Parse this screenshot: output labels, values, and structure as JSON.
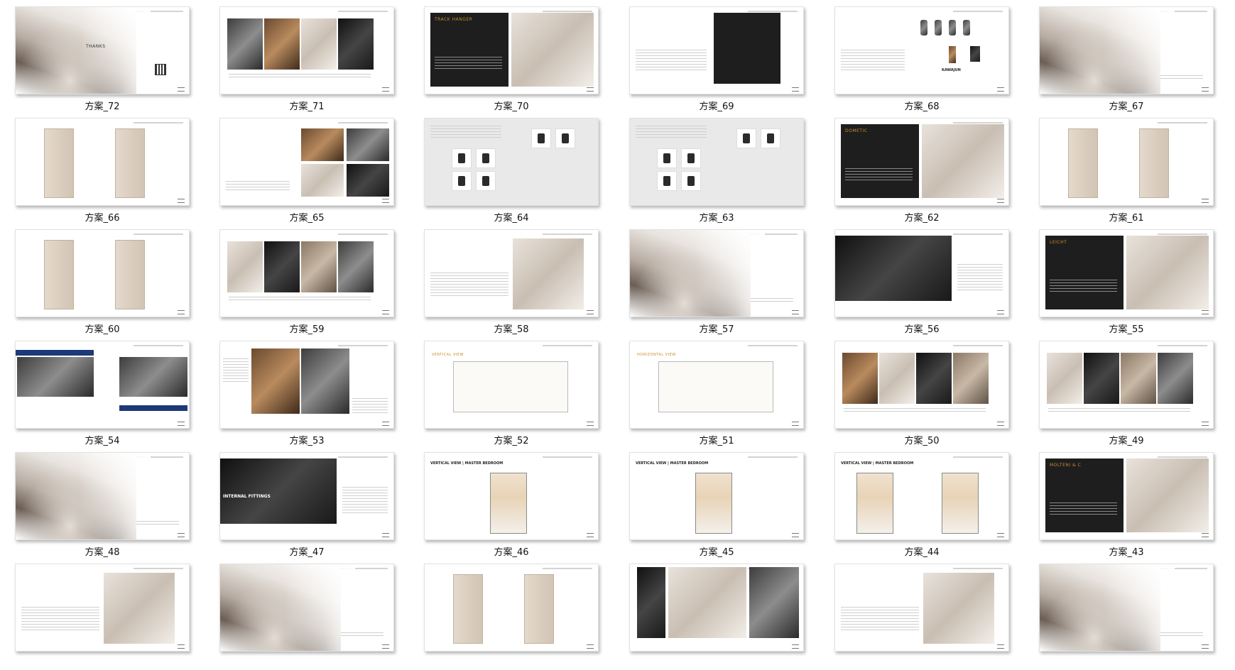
{
  "thumbnails": [
    {
      "id": "t72",
      "caption": "方案_72",
      "kind": "thanks",
      "label": "THANKS"
    },
    {
      "id": "t71",
      "caption": "方案_71",
      "kind": "photos-strip"
    },
    {
      "id": "t70",
      "caption": "方案_70",
      "kind": "dark-title",
      "label": "TRACK HANGER"
    },
    {
      "id": "t69",
      "caption": "方案_69",
      "kind": "text-dark-right"
    },
    {
      "id": "t68",
      "caption": "方案_68",
      "kind": "hardware",
      "label": "KAWAJUN"
    },
    {
      "id": "t67",
      "caption": "方案_67",
      "kind": "room"
    },
    {
      "id": "t66",
      "caption": "方案_66",
      "kind": "cabinets-2"
    },
    {
      "id": "t65",
      "caption": "方案_65",
      "kind": "text-grid-right"
    },
    {
      "id": "t64",
      "caption": "方案_64",
      "kind": "gray-icons"
    },
    {
      "id": "t63",
      "caption": "方案_63",
      "kind": "gray-appliances"
    },
    {
      "id": "t62",
      "caption": "方案_62",
      "kind": "dark-title",
      "label": "DOMETIC"
    },
    {
      "id": "t61",
      "caption": "方案_61",
      "kind": "cabinets-2"
    },
    {
      "id": "t60",
      "caption": "方案_60",
      "kind": "cabinets-2"
    },
    {
      "id": "t59",
      "caption": "方案_59",
      "kind": "photos-strip"
    },
    {
      "id": "t58",
      "caption": "方案_58",
      "kind": "text-photo-right"
    },
    {
      "id": "t57",
      "caption": "方案_57",
      "kind": "room"
    },
    {
      "id": "t56",
      "caption": "方案_56",
      "kind": "big-photo-left"
    },
    {
      "id": "t55",
      "caption": "方案_55",
      "kind": "dark-title",
      "label": "LEICHT"
    },
    {
      "id": "t54",
      "caption": "方案_54",
      "kind": "people"
    },
    {
      "id": "t53",
      "caption": "方案_53",
      "kind": "text-photo-mid"
    },
    {
      "id": "t52",
      "caption": "方案_52",
      "kind": "drawing",
      "label": "VERTICAL VIEW"
    },
    {
      "id": "t51",
      "caption": "方案_51",
      "kind": "drawing",
      "label": "HORIZONTAL VIEW"
    },
    {
      "id": "t50",
      "caption": "方案_50",
      "kind": "photos-strip"
    },
    {
      "id": "t49",
      "caption": "方案_49",
      "kind": "photos-strip"
    },
    {
      "id": "t48",
      "caption": "方案_48",
      "kind": "room"
    },
    {
      "id": "t47",
      "caption": "方案_47",
      "kind": "big-photo-left",
      "label": "INTERNAL FITTINGS"
    },
    {
      "id": "t46",
      "caption": "方案_46",
      "kind": "wardrobe-1",
      "label": "VERTICAL VIEW | MASTER BEDROOM"
    },
    {
      "id": "t45",
      "caption": "方案_45",
      "kind": "wardrobe-1",
      "label": "VERTICAL VIEW | MASTER BEDROOM"
    },
    {
      "id": "t44",
      "caption": "方案_44",
      "kind": "wardrobe-2",
      "label": "VERTICAL VIEW | MASTER BEDROOM"
    },
    {
      "id": "t43",
      "caption": "方案_43",
      "kind": "dark-title",
      "label": "MOLTENI & C"
    },
    {
      "id": "t42",
      "caption": "",
      "kind": "text-photo-right"
    },
    {
      "id": "t41",
      "caption": "",
      "kind": "room"
    },
    {
      "id": "t40",
      "caption": "",
      "kind": "cabinets-2"
    },
    {
      "id": "t39",
      "caption": "",
      "kind": "appliance-panel"
    },
    {
      "id": "t38",
      "caption": "",
      "kind": "text-photo-right"
    },
    {
      "id": "t37",
      "caption": "",
      "kind": "room"
    }
  ]
}
